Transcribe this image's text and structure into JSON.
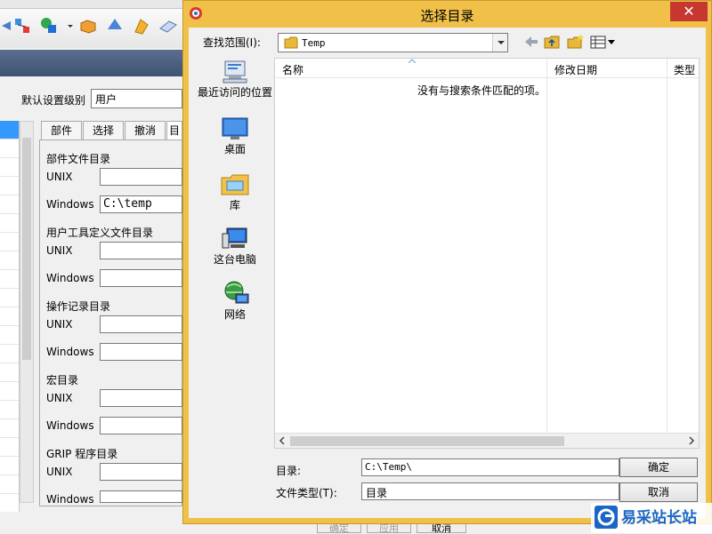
{
  "background_app": {
    "default_level_label": "默认设置级别",
    "default_level_value": "用户",
    "tabs": [
      "部件",
      "选择",
      "撤消",
      "目"
    ],
    "groups": [
      {
        "title": "部件文件目录",
        "unix_label": "UNIX",
        "unix_value": "",
        "windows_label": "Windows",
        "windows_value": "C:\\temp"
      },
      {
        "title": "用户工具定义文件目录",
        "unix_label": "UNIX",
        "unix_value": "",
        "windows_label": "Windows",
        "windows_value": ""
      },
      {
        "title": "操作记录目录",
        "unix_label": "UNIX",
        "unix_value": "",
        "windows_label": "Windows",
        "windows_value": ""
      },
      {
        "title": "宏目录",
        "unix_label": "UNIX",
        "unix_value": "",
        "windows_label": "Windows",
        "windows_value": ""
      },
      {
        "title": "GRIP 程序目录",
        "unix_label": "UNIX",
        "unix_value": "",
        "windows_label": "Windows",
        "windows_value": ""
      }
    ],
    "bottom_buttons": [
      "确定",
      "应用",
      "取消"
    ]
  },
  "dialog": {
    "title": "选择目录",
    "close_glyph": "✕",
    "look_in_label": "查找范围(I):",
    "look_in_value": "Temp",
    "places": [
      {
        "label": "最近访问的位置",
        "icon": "recent-places-icon"
      },
      {
        "label": "桌面",
        "icon": "desktop-icon"
      },
      {
        "label": "库",
        "icon": "library-icon"
      },
      {
        "label": "这台电脑",
        "icon": "this-pc-icon"
      },
      {
        "label": "网络",
        "icon": "network-icon"
      }
    ],
    "columns": [
      "名称",
      "修改日期",
      "类型"
    ],
    "empty_message": "没有与搜索条件匹配的项。",
    "directory_label": "目录:",
    "directory_value": "C:\\Temp\\",
    "file_type_label": "文件类型(T):",
    "file_type_value": "目录",
    "ok_label": "确定",
    "cancel_label": "取消"
  },
  "watermark": {
    "text": "易采站长站"
  },
  "colors": {
    "title_bar": "#f0c048",
    "close_button": "#c7372f",
    "selection": "#3399ff",
    "watermark": "#1a66c6"
  }
}
